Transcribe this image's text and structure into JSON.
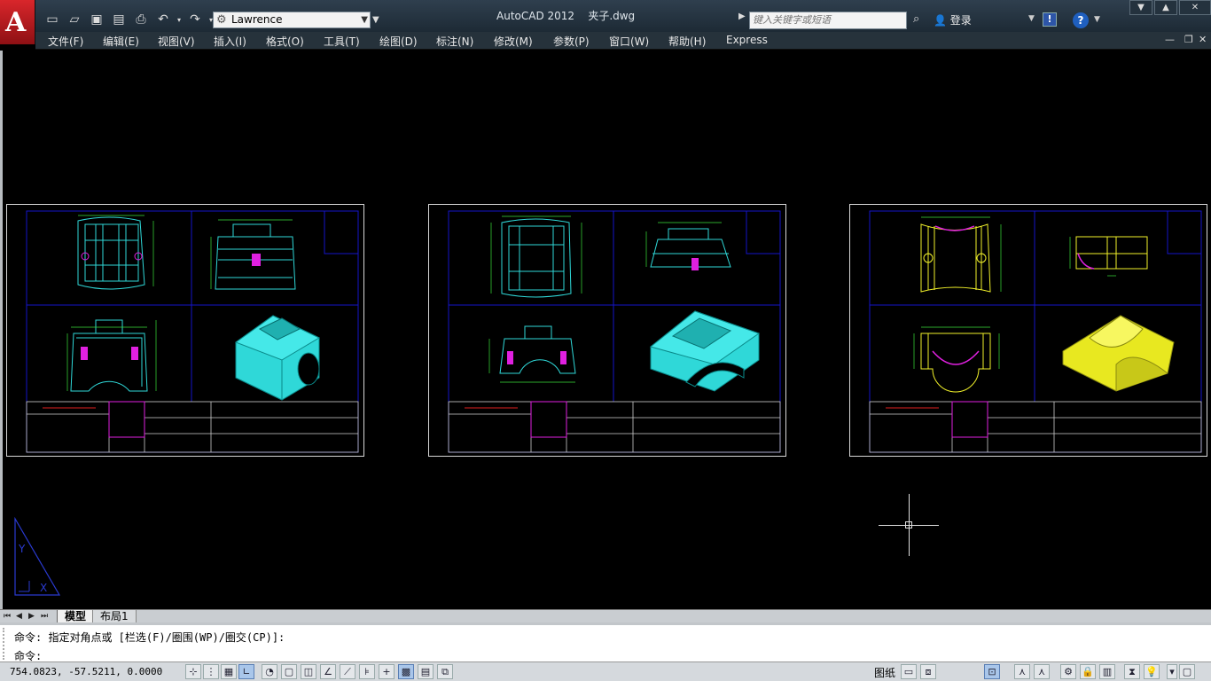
{
  "titlebar": {
    "workspace": "Lawrence",
    "app_title": "AutoCAD 2012",
    "file_name": "夹子.dwg",
    "search_placeholder": "键入关键字或短语",
    "login": "登录"
  },
  "menu": [
    "文件(F)",
    "编辑(E)",
    "视图(V)",
    "插入(I)",
    "格式(O)",
    "工具(T)",
    "绘图(D)",
    "标注(N)",
    "修改(M)",
    "参数(P)",
    "窗口(W)",
    "帮助(H)",
    "Express"
  ],
  "tabs": {
    "model": "模型",
    "layout1": "布局1"
  },
  "command": {
    "history": "命令: 指定对角点或 [栏选(F)/圈围(WP)/圈交(CP)]:",
    "prompt": "命令:"
  },
  "status": {
    "coordinates": "754.0823, -57.5211, 0.0000",
    "paper": "图纸"
  },
  "colors": {
    "part1": "#2fd8d8",
    "part2": "#2fd8d8",
    "part3": "#f2f22a",
    "frame": "#1515c8",
    "dim": "#3ae23a",
    "highlight": "#e020e0"
  }
}
